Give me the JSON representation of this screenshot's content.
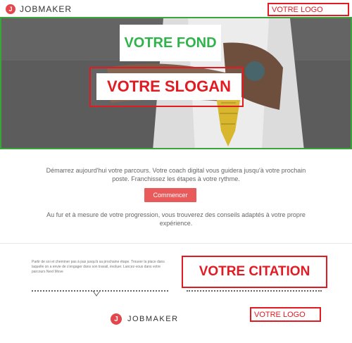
{
  "header": {
    "brand_mark": "J",
    "brand_name": "JOBMAKER",
    "logo_placeholder": "VOTRE LOGO"
  },
  "hero": {
    "background_label": "VOTRE FOND",
    "slogan_label": "VOTRE SLOGAN"
  },
  "content": {
    "intro": "Démarrez aujourd'hui votre parcours. Votre coach digital vous guidera jusqu'à votre prochain poste. Franchissez les étapes à votre rythme.",
    "cta_label": "Commencer",
    "advice": "Au fur et à mesure de votre progression, vous trouverez des conseils adaptés à votre propre expérience."
  },
  "footer": {
    "description": "Partir de soi et cheminer pas à pas jusqu'à sa prochaine étape. Trouver la place dans laquelle on a envie de s'engager dans son travail, évoluer. Lancez-vous dans votre parcours Next Move",
    "citation_label": "VOTRE CITATION",
    "logo_placeholder": "VOTRE LOGO",
    "brand_mark": "J",
    "brand_name": "JOBMAKER"
  },
  "colors": {
    "accent_red": "#e21b22",
    "button_red": "#e95b5b",
    "highlight_green": "#3aa53a",
    "tie_yellow": "#d8b72e"
  }
}
